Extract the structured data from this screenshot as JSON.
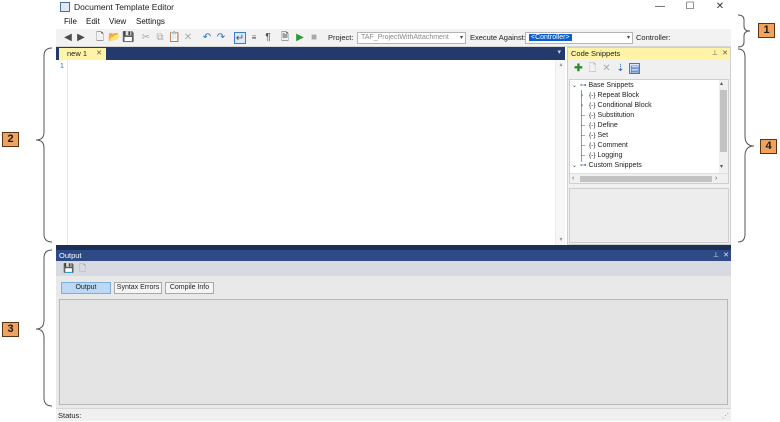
{
  "window": {
    "title": "Document Template Editor",
    "minimize_glyph": "—",
    "maximize_glyph": "☐",
    "close_glyph": "✕"
  },
  "menu": [
    "File",
    "Edit",
    "View",
    "Settings"
  ],
  "toolbar": {
    "project_label": "Project:",
    "project_value": "TAF_ProjectWithAttachment",
    "execute_label": "Execute Against:",
    "execute_value": "<Controller>",
    "controller_label": "Controller:",
    "pilcrow": "¶"
  },
  "editor": {
    "tab_label": "new 1",
    "tab_close": "✕",
    "line_numbers": [
      "1"
    ]
  },
  "snippets": {
    "title": "Code Snippets",
    "pin": "⊥",
    "close": "✕",
    "tree": {
      "base_label": "Base Snippets",
      "base_items": [
        "Repeat Block",
        "Conditional Block",
        "Substitution",
        "Define",
        "Set",
        "Comment",
        "Logging"
      ],
      "item_prefix": "{-}",
      "custom_label": "Custom Snippets"
    }
  },
  "output": {
    "title": "Output",
    "pin": "⊥",
    "close": "✕",
    "tabs": [
      "Output",
      "Syntax Errors",
      "Compile Info"
    ],
    "active_tab": "Output"
  },
  "status": {
    "label": "Status:"
  },
  "callouts": [
    "1",
    "2",
    "3",
    "4"
  ],
  "colors": {
    "accent": "#243a6c",
    "tab_highlight": "#fff3a8",
    "callout": "#f0a35e",
    "selection": "#0b5fd1"
  }
}
